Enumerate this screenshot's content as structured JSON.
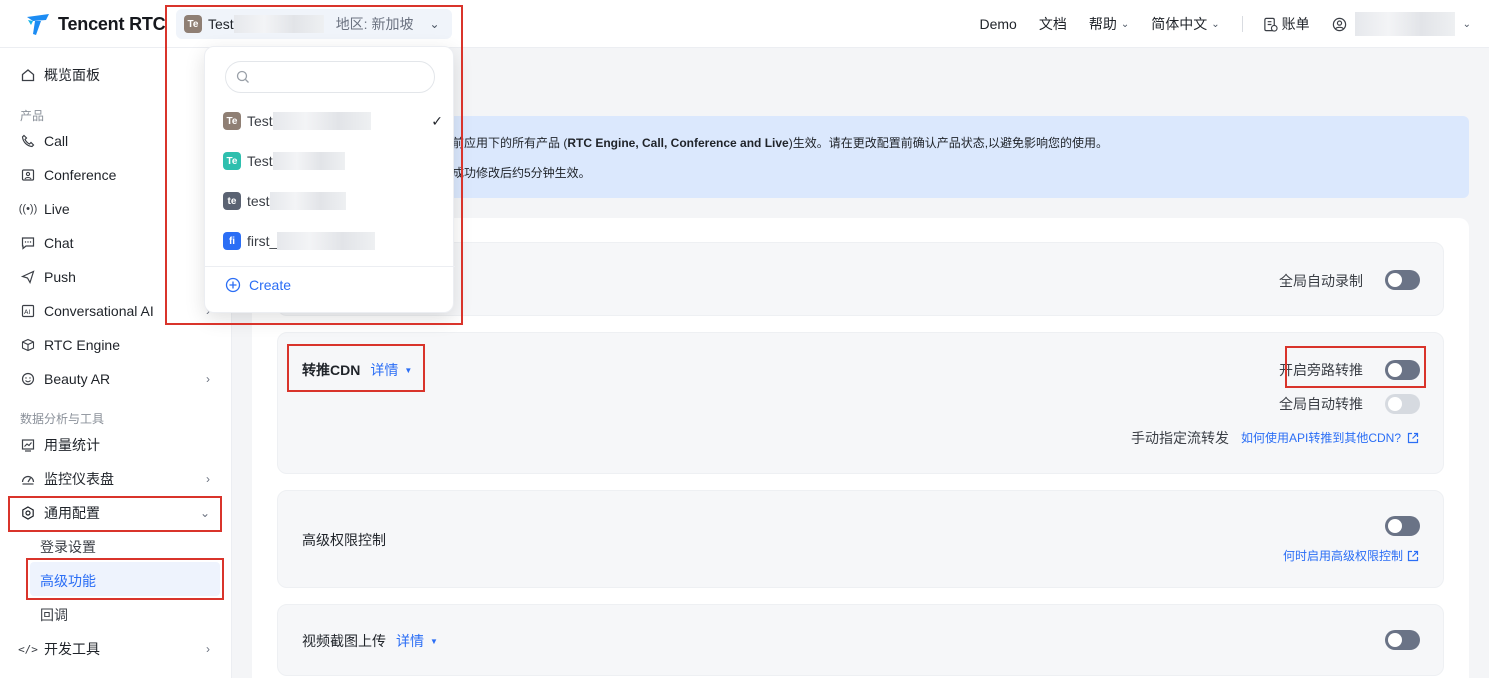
{
  "header": {
    "logo_text": "Tencent RTC",
    "app_selector": {
      "badge": "Te",
      "badge_color": "#8f7f74",
      "app_name": "Test",
      "region": "地区: 新加坡"
    },
    "nav": {
      "demo": "Demo",
      "docs": "文档",
      "help": "帮助",
      "language": "简体中文",
      "billing": "账单"
    }
  },
  "dropdown": {
    "search_value": "",
    "items": [
      {
        "badge": "Te",
        "color": "#8f7f74",
        "name": "Test",
        "selected": true
      },
      {
        "badge": "Te",
        "color": "#2ebfae",
        "name": "Test"
      },
      {
        "badge": "te",
        "color": "#5a6272",
        "name": "test"
      },
      {
        "badge": "fi",
        "color": "#2b6ef5",
        "name": "first_"
      }
    ],
    "create": "Create"
  },
  "sidebar": {
    "overview": "概览面板",
    "section_products": "产品",
    "products": [
      "Call",
      "Conference",
      "Live",
      "Chat",
      "Push",
      "Conversational AI",
      "RTC Engine",
      "Beauty AR"
    ],
    "section_analytics": "数据分析与工具",
    "usage": "用量统计",
    "monitor": "监控仪表盘",
    "general_config": "通用配置",
    "sub": {
      "login": "登录设置",
      "advanced": "高级功能",
      "callback": "回调"
    },
    "devtools": "开发工具"
  },
  "banner": {
    "line1_pre": "前应用下的所有产品 (",
    "line1_bold": "RTC Engine, Call, Conference and Live",
    "line1_post": ")生效。请在更改配置前确认产品状态,以避免影响您的使用。",
    "line2": "成功修改后约5分钟生效。"
  },
  "cards": {
    "recording": {
      "toggle_label": "全局自动录制"
    },
    "cdn": {
      "title": "转推CDN",
      "detail": "详情",
      "bypass_label": "开启旁路转推",
      "auto_label": "全局自动转推",
      "manual_label": "手动指定流转发",
      "manual_link": "如何使用API转推到其他CDN?"
    },
    "permission": {
      "title": "高级权限控制",
      "link": "何时启用高级权限控制"
    },
    "snapshot": {
      "title": "视频截图上传",
      "detail": "详情"
    }
  },
  "colors": {
    "accent": "#2b6ef5",
    "highlight": "#d9342b",
    "toggle_off": "#6a7386",
    "banner": "#dbe8fd"
  }
}
